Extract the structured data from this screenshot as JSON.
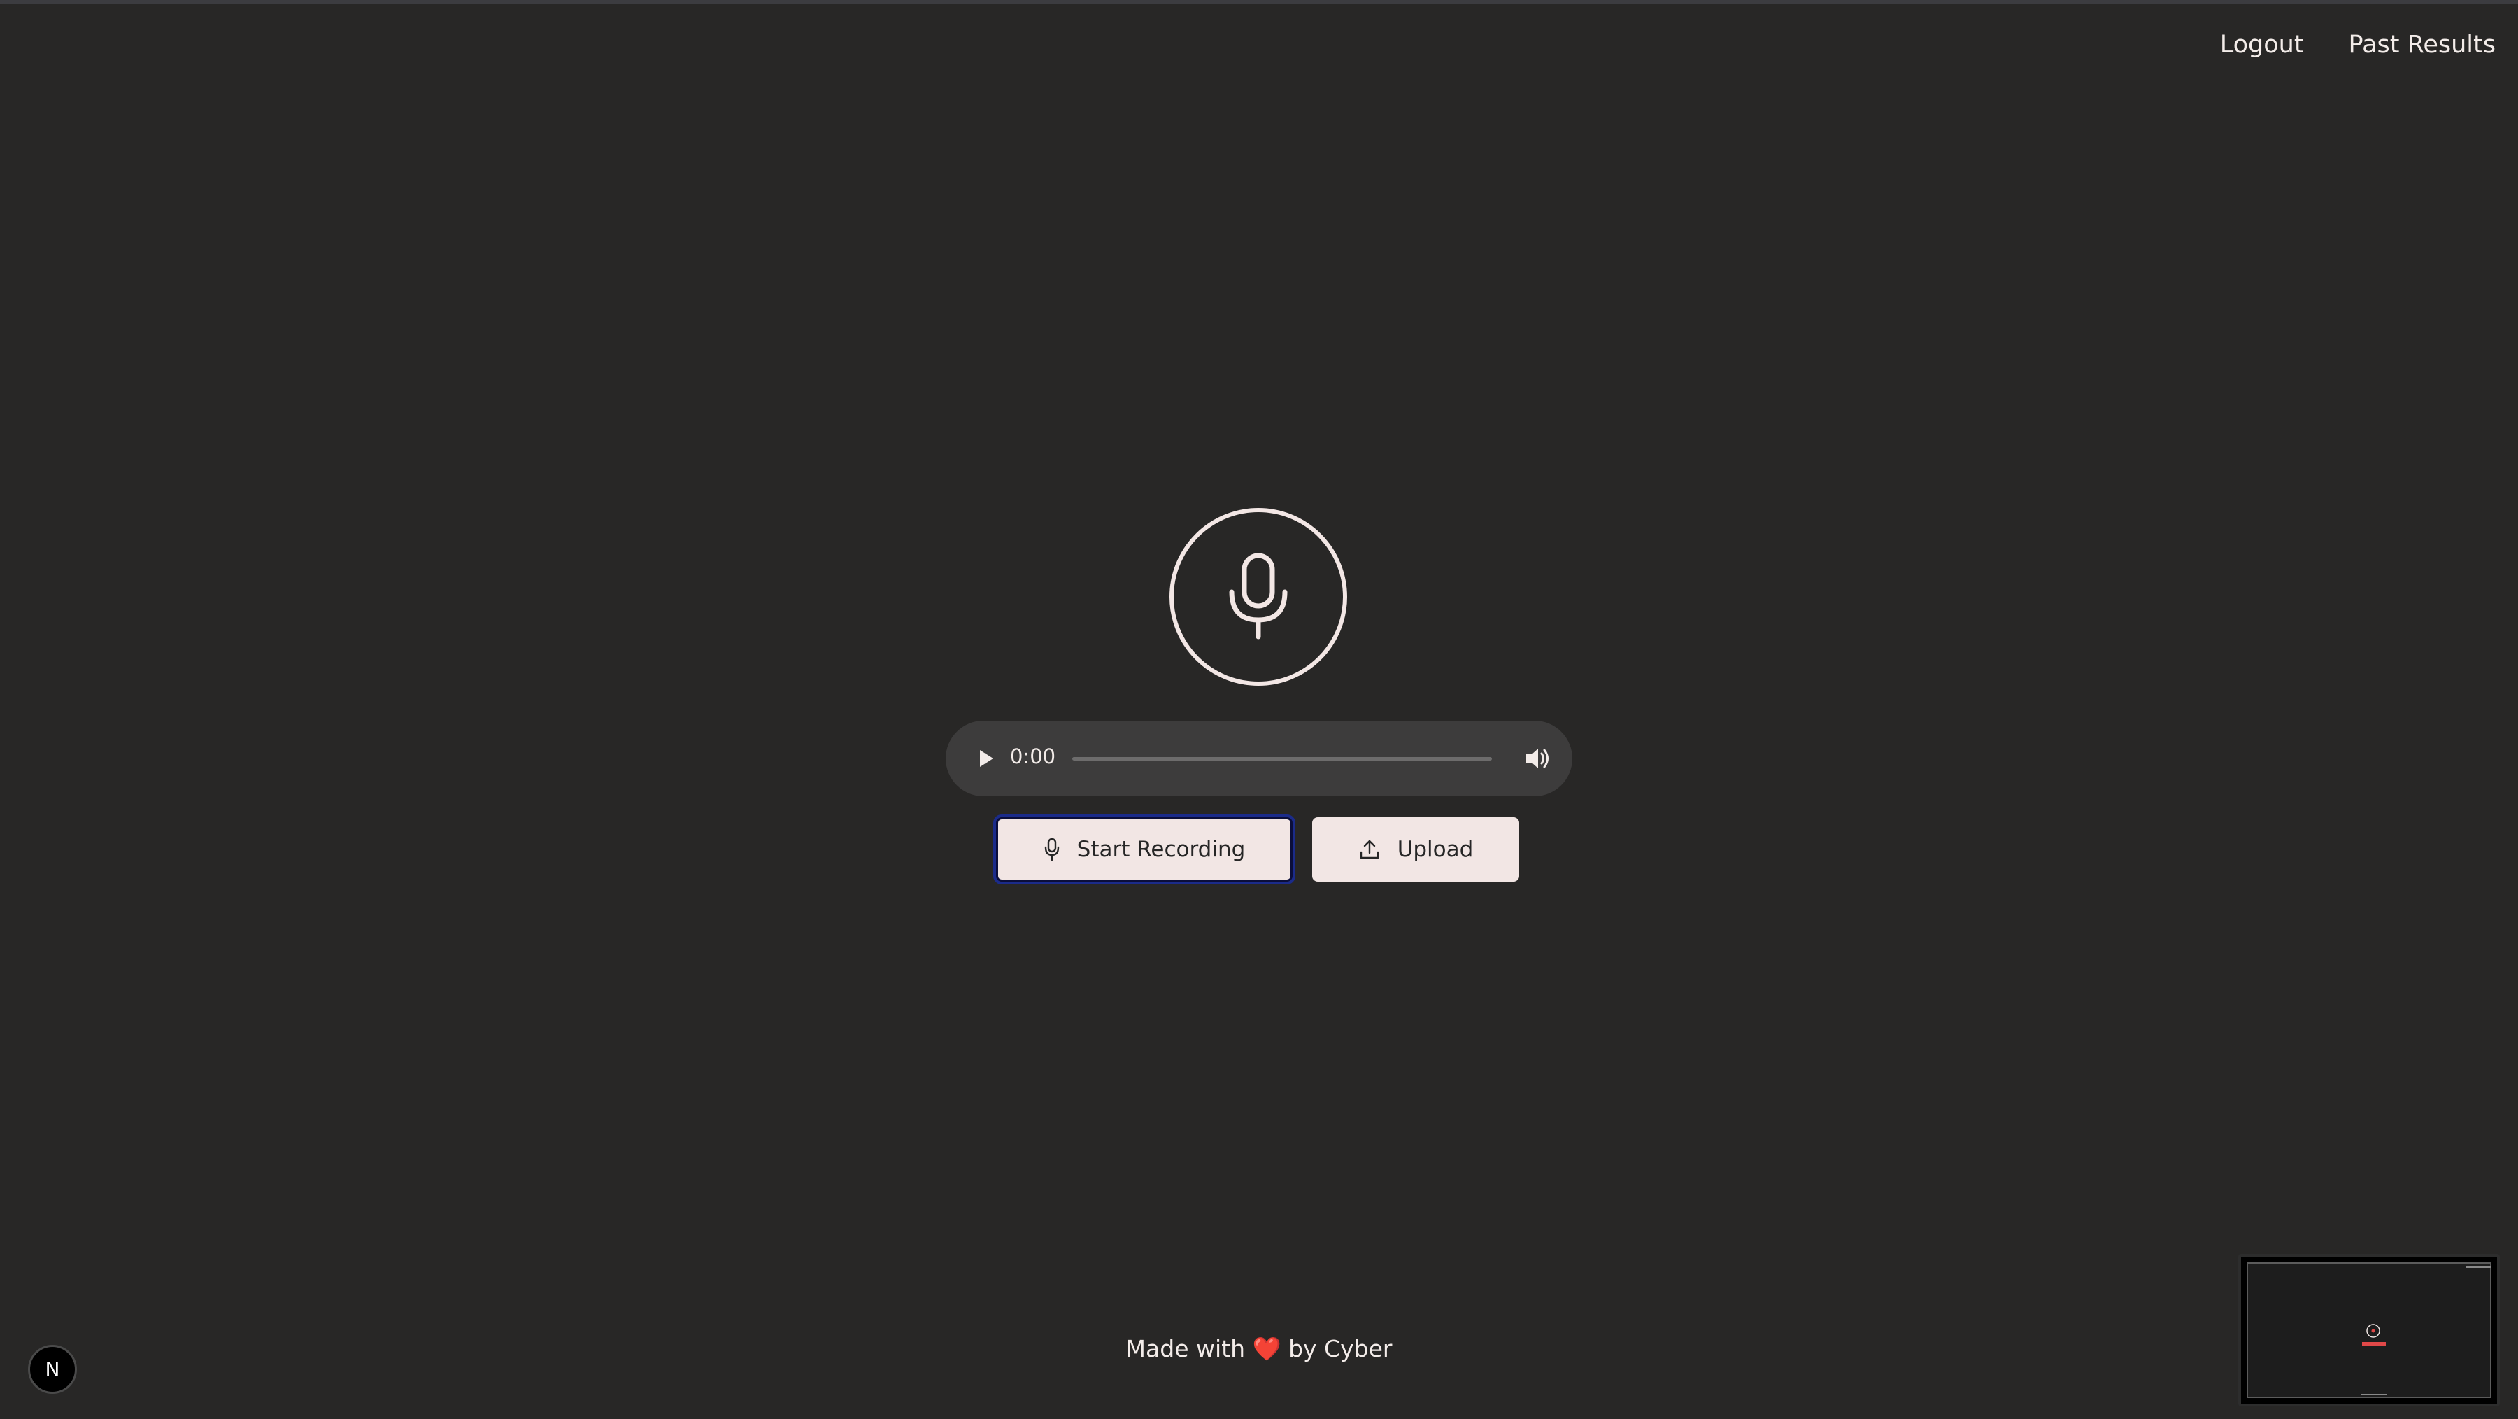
{
  "nav": {
    "logout_label": "Logout",
    "past_results_label": "Past Results"
  },
  "player": {
    "time": "0:00",
    "progress": 0
  },
  "actions": {
    "record_label": "Start Recording",
    "upload_label": "Upload"
  },
  "footer": {
    "prefix": "Made with",
    "heart": "❤️",
    "suffix": "by Cyber"
  },
  "badge": {
    "letter": "N"
  },
  "colors": {
    "background": "#282726",
    "button_bg": "#f2e6e4",
    "focus_outline": "#1b2b8a",
    "text": "#f3ece9"
  },
  "icons": {
    "main": "microphone-icon",
    "play": "play-icon",
    "volume": "volume-icon",
    "record": "microphone-icon",
    "upload": "upload-icon"
  }
}
